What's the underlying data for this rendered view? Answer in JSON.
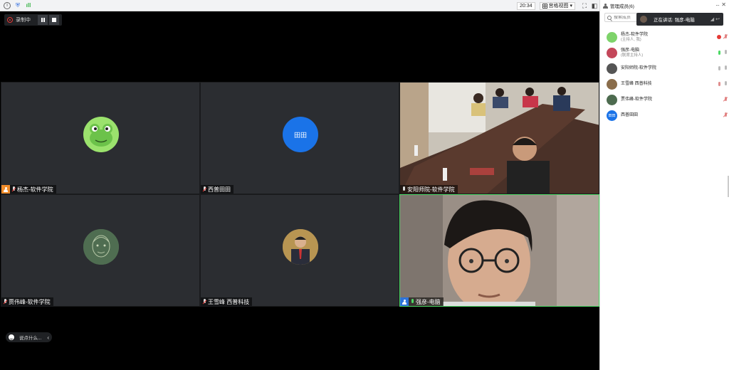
{
  "topbar": {
    "time": "20:34",
    "view_label": "宫格视图",
    "view_caret": "▾"
  },
  "recording": {
    "label": "录制中"
  },
  "tiles": [
    {
      "name": "杨杰-软件学院",
      "is_host": true
    },
    {
      "name": "西普田田",
      "avatar_text": "田田"
    },
    {
      "name": "安阳师院-软件学院"
    },
    {
      "name": "贾伟峰-软件学院"
    },
    {
      "name": "王雪峰 西普科技"
    },
    {
      "name": "强彦-电脑",
      "is_cohost": true
    }
  ],
  "sidebar": {
    "title": "管理成员(6)",
    "more": "···",
    "close": "✕",
    "search_placeholder": "搜索成员",
    "speaking": "正在讲话: 强彦-电脑",
    "members": [
      {
        "name": "杨杰-软件学院",
        "role": "(主持人, 我)",
        "avatar_color": "#7ed36a"
      },
      {
        "name": "强彦-电脑",
        "role": "(联席主持人)",
        "avatar_color": "#c4475a"
      },
      {
        "name": "安阳师院-软件学院",
        "role": "",
        "avatar_color": "#555555"
      },
      {
        "name": "王雪峰 西普科技",
        "role": "",
        "avatar_color": "#8a6d4b"
      },
      {
        "name": "贾伟峰-软件学院",
        "role": "",
        "avatar_color": "#4d6b4f"
      },
      {
        "name": "西普田田",
        "role": "",
        "avatar_color": "#1a73e8",
        "avatar_text": "田田"
      }
    ]
  },
  "chat": {
    "placeholder": "说点什么...",
    "chevron": "‹"
  },
  "colors": {
    "accent_blue": "#1a73e8",
    "record_red": "#e53935",
    "tile_bg": "#2b2d31"
  }
}
